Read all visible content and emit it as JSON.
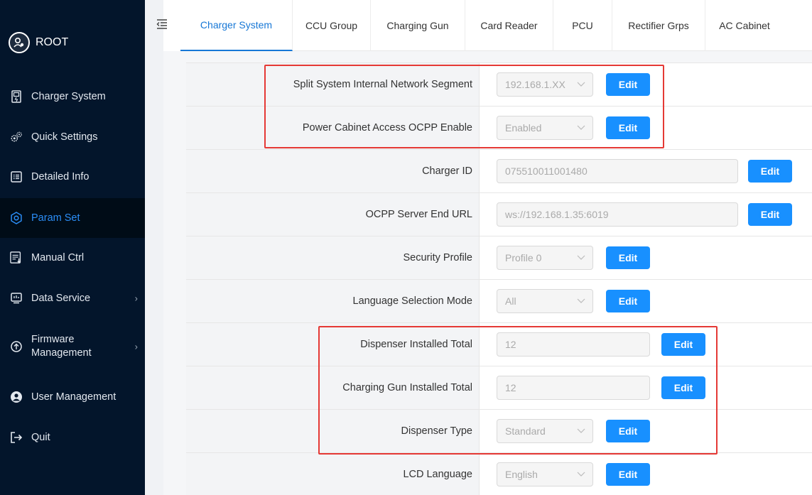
{
  "user": {
    "name": "ROOT"
  },
  "sidebar": {
    "items": [
      {
        "label": "Charger System",
        "icon": "charger-icon"
      },
      {
        "label": "Quick Settings",
        "icon": "gears-icon"
      },
      {
        "label": "Detailed Info",
        "icon": "list-icon"
      },
      {
        "label": "Param Set",
        "icon": "gear-icon",
        "active": true
      },
      {
        "label": "Manual Ctrl",
        "icon": "manual-icon"
      },
      {
        "label": "Data Service",
        "icon": "data-icon",
        "has_submenu": true
      },
      {
        "label_line1": "Firmware",
        "label_line2": "Management",
        "icon": "upload-icon",
        "has_submenu": true
      },
      {
        "label": "User Management",
        "icon": "user-icon"
      },
      {
        "label": "Quit",
        "icon": "quit-icon"
      }
    ]
  },
  "tabs": [
    {
      "label": "Charger System",
      "active": true
    },
    {
      "label": "CCU Group"
    },
    {
      "label": "Charging Gun"
    },
    {
      "label": "Card Reader"
    },
    {
      "label": "PCU"
    },
    {
      "label": "Rectifier Grps"
    },
    {
      "label": "AC Cabinet"
    }
  ],
  "params": [
    {
      "label": "Split System Internal Network Segment",
      "value": "192.168.1.XX",
      "kind": "select",
      "edit": "Edit"
    },
    {
      "label": "Power Cabinet Access OCPP Enable",
      "value": "Enabled",
      "kind": "select",
      "edit": "Edit"
    },
    {
      "label": "Charger ID",
      "value": "075510011001480",
      "kind": "input-wide",
      "edit": "Edit"
    },
    {
      "label": "OCPP Server End URL",
      "value": "ws://192.168.1.35:6019",
      "kind": "input-wide",
      "edit": "Edit"
    },
    {
      "label": "Security Profile",
      "value": "Profile 0",
      "kind": "select",
      "edit": "Edit"
    },
    {
      "label": "Language Selection Mode",
      "value": "All",
      "kind": "select",
      "edit": "Edit"
    },
    {
      "label": "Dispenser Installed Total",
      "value": "12",
      "kind": "input",
      "edit": "Edit"
    },
    {
      "label": "Charging Gun Installed Total",
      "value": "12",
      "kind": "input",
      "edit": "Edit"
    },
    {
      "label": "Dispenser Type",
      "value": "Standard",
      "kind": "select",
      "edit": "Edit"
    },
    {
      "label": "LCD Language",
      "value": "English",
      "kind": "select",
      "edit": "Edit"
    }
  ],
  "colors": {
    "sidebar_bg": "#03152b",
    "accent": "#1890ff",
    "annotation": "#e53935"
  }
}
